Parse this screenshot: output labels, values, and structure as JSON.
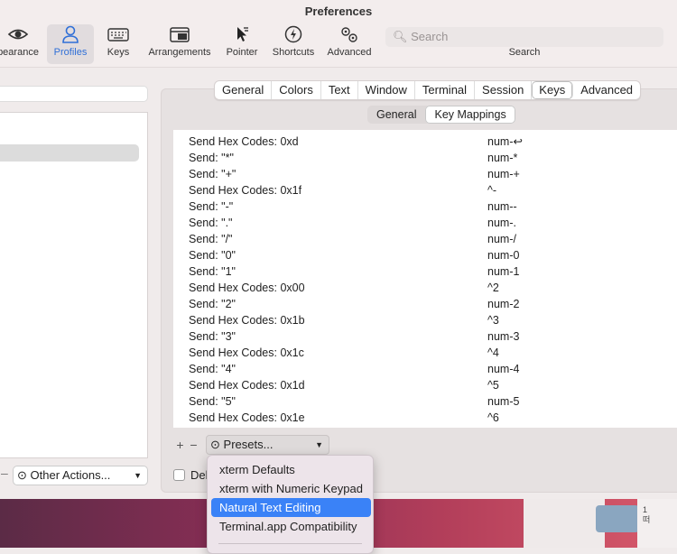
{
  "window": {
    "title": "Preferences"
  },
  "toolbar": {
    "items": [
      {
        "label": "pearance",
        "icon": "eye-icon"
      },
      {
        "label": "Profiles",
        "icon": "person-icon",
        "selected": true
      },
      {
        "label": "Keys",
        "icon": "keyboard-icon"
      },
      {
        "label": "Arrangements",
        "icon": "window-icon"
      },
      {
        "label": "Pointer",
        "icon": "cursor-icon"
      },
      {
        "label": "Shortcuts",
        "icon": "lightning-icon"
      },
      {
        "label": "Advanced",
        "icon": "gears-icon"
      }
    ],
    "search_placeholder": "Search",
    "search_caption": "Search"
  },
  "tabs": [
    "General",
    "Colors",
    "Text",
    "Window",
    "Terminal",
    "Session",
    "Keys",
    "Advanced"
  ],
  "selected_tab": "Keys",
  "subtabs": [
    "General",
    "Key Mappings"
  ],
  "selected_subtab": "Key Mappings",
  "key_mappings": [
    {
      "action": "Send Hex Codes: 0xd",
      "key": "num-↩"
    },
    {
      "action": "Send: \"*\"",
      "key": "num-*"
    },
    {
      "action": "Send: \"+\"",
      "key": "num-+"
    },
    {
      "action": "Send Hex Codes: 0x1f",
      "key": "^-"
    },
    {
      "action": "Send: \"-\"",
      "key": "num--"
    },
    {
      "action": "Send: \".\"",
      "key": "num-."
    },
    {
      "action": "Send: \"/\"",
      "key": "num-/"
    },
    {
      "action": "Send: \"0\"",
      "key": "num-0"
    },
    {
      "action": "Send: \"1\"",
      "key": "num-1"
    },
    {
      "action": "Send Hex Codes: 0x00",
      "key": "^2"
    },
    {
      "action": "Send: \"2\"",
      "key": "num-2"
    },
    {
      "action": "Send Hex Codes: 0x1b",
      "key": "^3"
    },
    {
      "action": "Send: \"3\"",
      "key": "num-3"
    },
    {
      "action": "Send Hex Codes: 0x1c",
      "key": "^4"
    },
    {
      "action": "Send: \"4\"",
      "key": "num-4"
    },
    {
      "action": "Send Hex Codes: 0x1d",
      "key": "^5"
    },
    {
      "action": "Send: \"5\"",
      "key": "num-5"
    },
    {
      "action": "Send Hex Codes: 0x1e",
      "key": "^6"
    }
  ],
  "controls": {
    "plus": "+",
    "minus": "−",
    "presets_label": "Presets...",
    "other_actions": "Other Actions...",
    "delete_label": "Del"
  },
  "presets_menu": {
    "items": [
      "xterm Defaults",
      "xterm with Numeric Keypad",
      "Natural Text Editing",
      "Terminal.app Compatibility"
    ],
    "highlighted": "Natural Text Editing"
  },
  "desktop": {
    "photo_text": "1\n떠"
  },
  "colors": {
    "accent": "#3a82f7",
    "selected_toolbar": "#2f6fd7"
  }
}
